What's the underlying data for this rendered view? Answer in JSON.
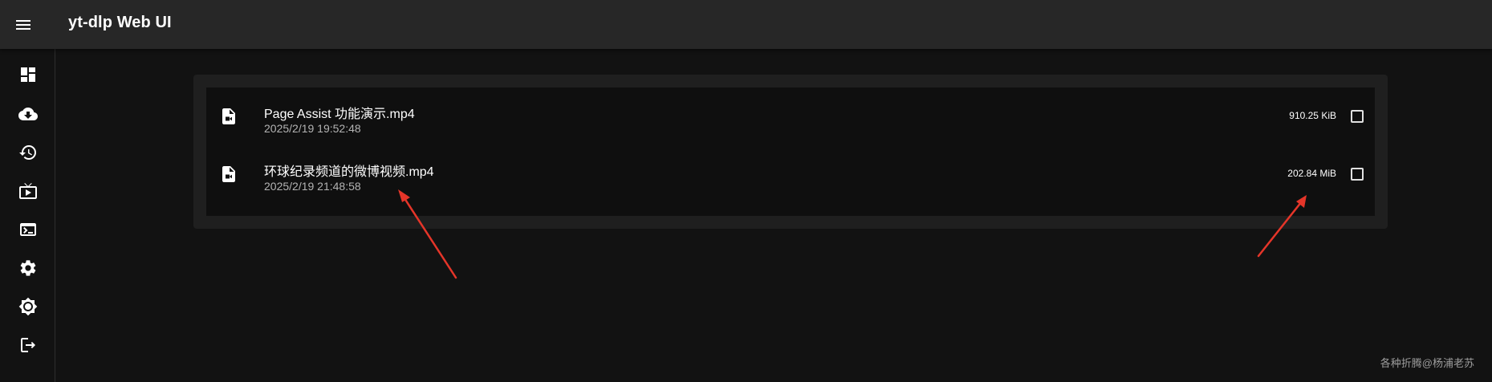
{
  "app": {
    "title": "yt-dlp Web UI"
  },
  "drawer": {
    "items": [
      {
        "icon": "dashboard-icon"
      },
      {
        "icon": "cloud-download-icon"
      },
      {
        "icon": "history-icon"
      },
      {
        "icon": "live-tv-icon"
      },
      {
        "icon": "terminal-icon"
      },
      {
        "icon": "settings-icon"
      },
      {
        "icon": "brightness-icon"
      },
      {
        "icon": "logout-icon"
      }
    ]
  },
  "files": [
    {
      "name": "Page Assist 功能演示.mp4",
      "date": "2025/2/19 19:52:48",
      "size": "910.25 KiB",
      "checked": false
    },
    {
      "name": "环球纪录频道的微博视频.mp4",
      "date": "2025/2/19 21:48:58",
      "size": "202.84 MiB",
      "checked": false
    }
  ],
  "annotations": {
    "arrow_color": "#e53529"
  },
  "watermark": "各种折腾@杨浦老苏",
  "colors": {
    "appbar": "#272727",
    "background": "#121212",
    "paper": "#1f1f1f",
    "list": "#0f0f0f"
  }
}
